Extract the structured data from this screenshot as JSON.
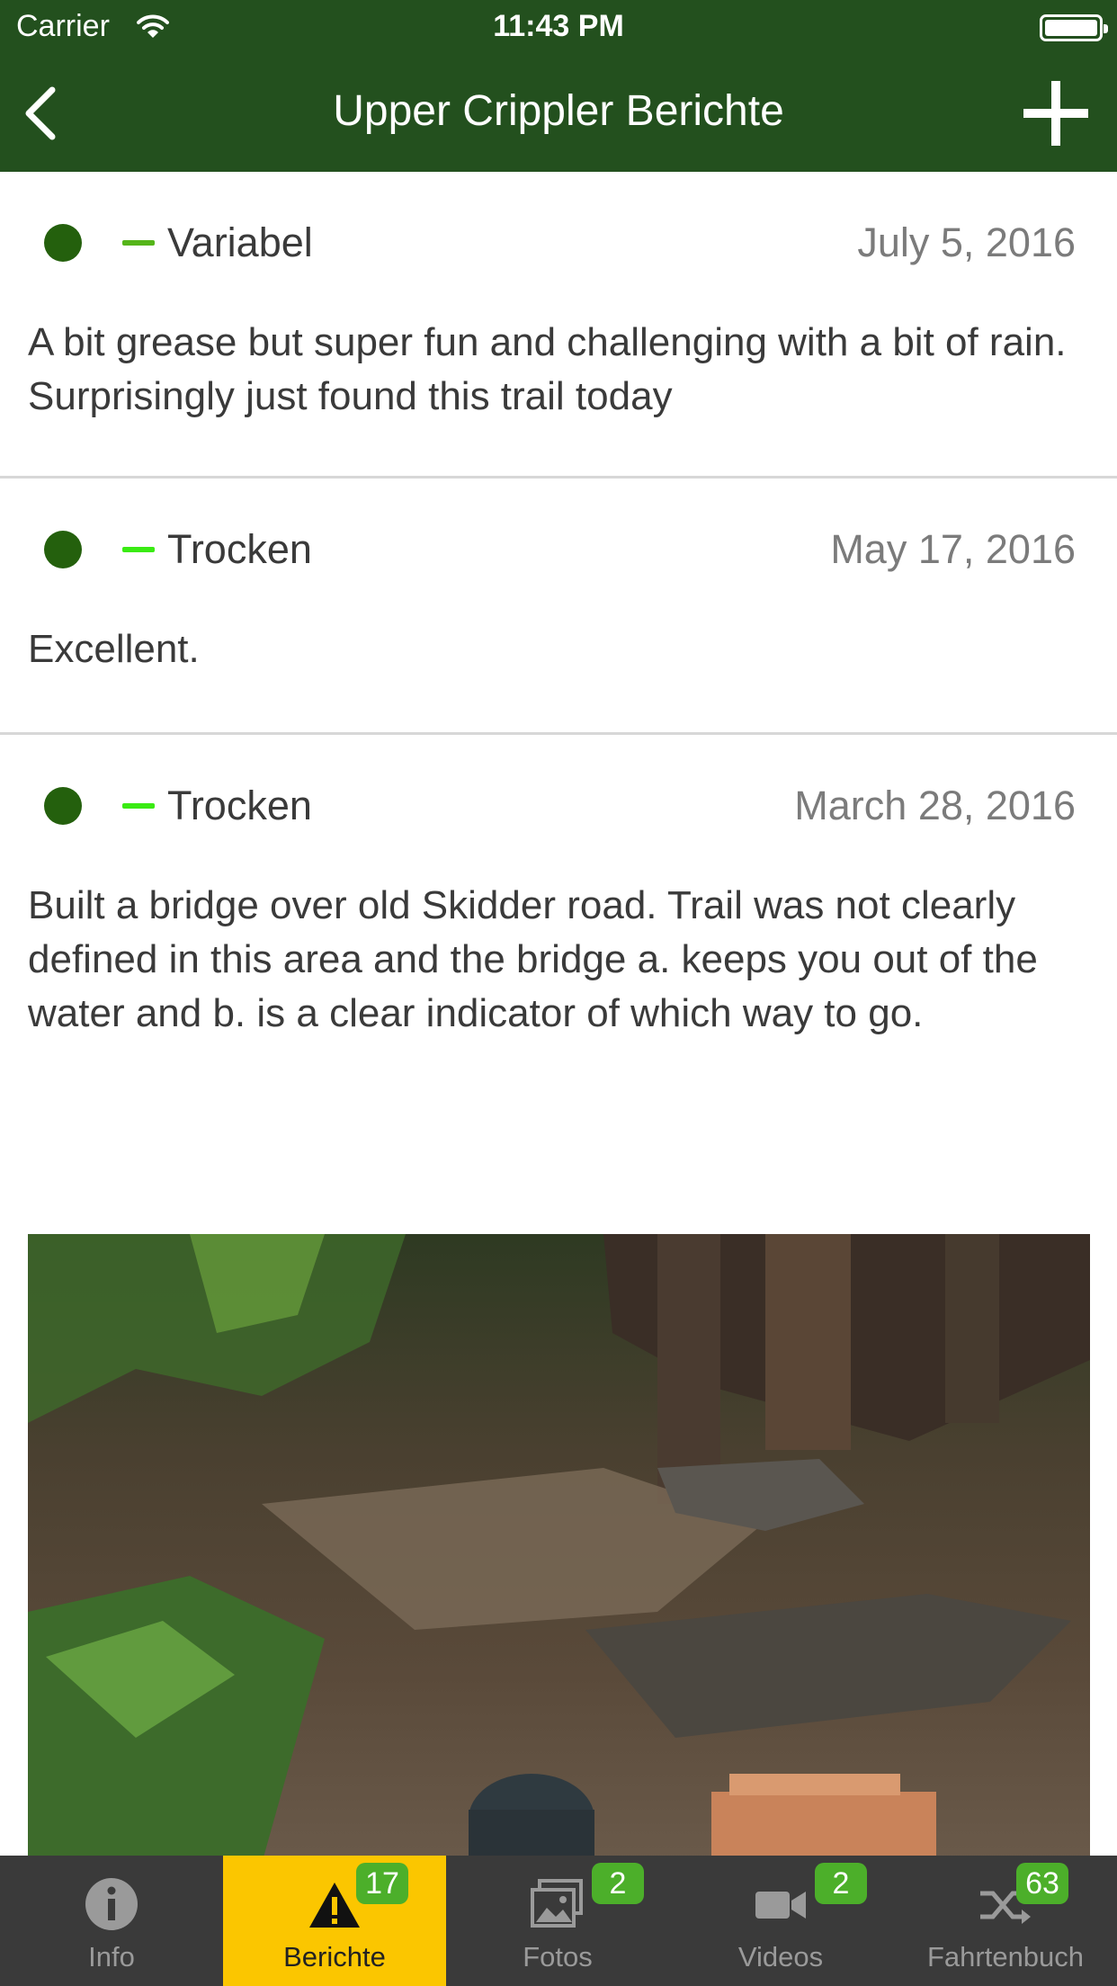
{
  "status_bar": {
    "carrier": "Carrier",
    "time": "11:43 PM"
  },
  "nav": {
    "title": "Upper Crippler Berichte",
    "back_icon": "chevron-left-icon",
    "add_icon": "plus-icon"
  },
  "reports": [
    {
      "condition": "Variabel",
      "condition_color": "#55b51a",
      "date": "July 5, 2016",
      "text": "A bit grease but super fun and challenging with a bit of rain. Surprisingly just found this trail today"
    },
    {
      "condition": "Trocken",
      "condition_color": "#3aeb13",
      "date": "May 17, 2016",
      "text": "Excellent."
    },
    {
      "condition": "Trocken",
      "condition_color": "#3aeb13",
      "date": "March 28, 2016",
      "text": "Built a bridge over old Skidder road. Trail was not clearly defined in this area and the bridge a. keeps you out of the water and b. is a clear indicator of which way to go."
    }
  ],
  "tabs": [
    {
      "label": "Info",
      "icon": "info-icon"
    },
    {
      "label": "Berichte",
      "icon": "warning-icon",
      "badge": "17",
      "active": true
    },
    {
      "label": "Fotos",
      "icon": "photos-icon",
      "badge": "2"
    },
    {
      "label": "Videos",
      "icon": "video-camera-icon",
      "badge": "2"
    },
    {
      "label": "Fahrtenbuch",
      "icon": "shuffle-icon",
      "badge": "63"
    }
  ],
  "colors": {
    "header": "#23501e",
    "active_tab": "#fbc600",
    "badge": "#4caf2a",
    "tabbar": "#3a3a3a",
    "status_dot": "#24600d"
  }
}
